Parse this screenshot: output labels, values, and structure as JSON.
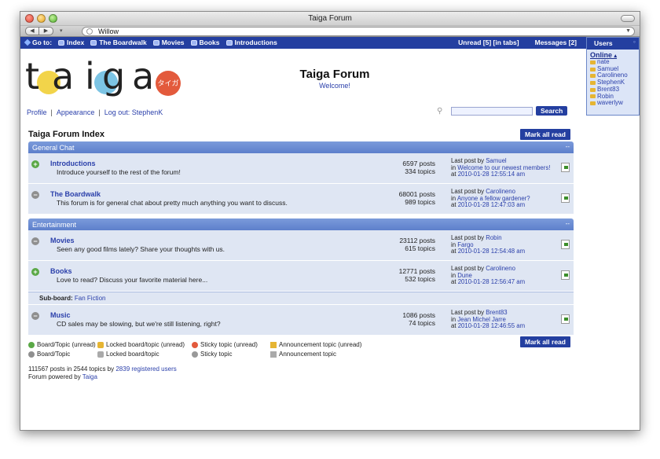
{
  "window": {
    "title": "Taiga Forum"
  },
  "browser": {
    "address": "Willow"
  },
  "nav": {
    "goto_label": "Go to:",
    "items": [
      "Index",
      "The Boardwalk",
      "Movies",
      "Books",
      "Introductions"
    ],
    "unread": "Unread [5] [in tabs]",
    "messages": "Messages [2]"
  },
  "users_panel": {
    "title": "Users",
    "online_label": "Online",
    "users": [
      "nate",
      "Samuel",
      "Carolineno",
      "StephenK",
      "Brent83",
      "Robin",
      "waverlyw"
    ]
  },
  "header": {
    "logo_letters": [
      "t",
      "a",
      "i",
      "g",
      "a"
    ],
    "logo_badge": "タイガ",
    "title": "Taiga Forum",
    "subtitle": "Welcome!",
    "links": {
      "profile": "Profile",
      "appearance": "Appearance",
      "logout": "Log out: StephenK"
    },
    "search_button": "Search"
  },
  "index": {
    "title": "Taiga Forum Index",
    "mark_all_read": "Mark all read"
  },
  "categories": [
    {
      "name": "General Chat",
      "collapse": "--",
      "boards": [
        {
          "name": "Introductions",
          "desc": "Introduce yourself to the rest of the forum!",
          "posts": "6597 posts",
          "topics": "334 topics",
          "last_by_label": "Last post by",
          "last_by": "Samuel",
          "in_label": "in",
          "in": "Welcome to our newest members!",
          "at_label": "at",
          "at": "2010-01-28 12:55:14 am",
          "unread": true
        },
        {
          "name": "The Boardwalk",
          "desc": "This forum is for general chat about pretty much anything you want to discuss.",
          "posts": "68001 posts",
          "topics": "989 topics",
          "last_by_label": "Last post by",
          "last_by": "Carolineno",
          "in_label": "in",
          "in": "Anyone a fellow gardener?",
          "at_label": "at",
          "at": "2010-01-28 12:47:03 am",
          "unread": false
        }
      ]
    },
    {
      "name": "Entertainment",
      "collapse": "--",
      "boards": [
        {
          "name": "Movies",
          "desc": "Seen any good films lately? Share your thoughts with us.",
          "posts": "23112 posts",
          "topics": "615 topics",
          "last_by_label": "Last post by",
          "last_by": "Robin",
          "in_label": "in",
          "in": "Fargo",
          "at_label": "at",
          "at": "2010-01-28 12:54:48 am",
          "unread": false
        },
        {
          "name": "Books",
          "desc": "Love to read? Discuss your favorite material here...",
          "posts": "12771 posts",
          "topics": "532 topics",
          "last_by_label": "Last post by",
          "last_by": "Carolineno",
          "in_label": "in",
          "in": "Dune",
          "at_label": "at",
          "at": "2010-01-28 12:56:47 am",
          "unread": true
        },
        {
          "name": "Music",
          "desc": "CD sales may be slowing, but we're still listening, right?",
          "posts": "1086 posts",
          "topics": "74 topics",
          "last_by_label": "Last post by",
          "last_by": "Brent83",
          "in_label": "in",
          "in": "Jean Michel Jarre",
          "at_label": "at",
          "at": "2010-01-28 12:46:55 am",
          "unread": false
        }
      ],
      "subboard_label": "Sub-board:",
      "subboard": "Fan Fiction"
    }
  ],
  "legend": [
    [
      "Board/Topic (unread)",
      "Locked board/topic (unread)",
      "Sticky topic (unread)",
      "Announcement topic (unread)"
    ],
    [
      "Board/Topic",
      "Locked board/topic",
      "Sticky topic",
      "Announcement topic"
    ]
  ],
  "footer": {
    "stats_prefix": "111567 posts in 2544 topics by",
    "users_link": "2839 registered users",
    "powered_prefix": "Forum powered by",
    "powered_link": "Taiga"
  }
}
